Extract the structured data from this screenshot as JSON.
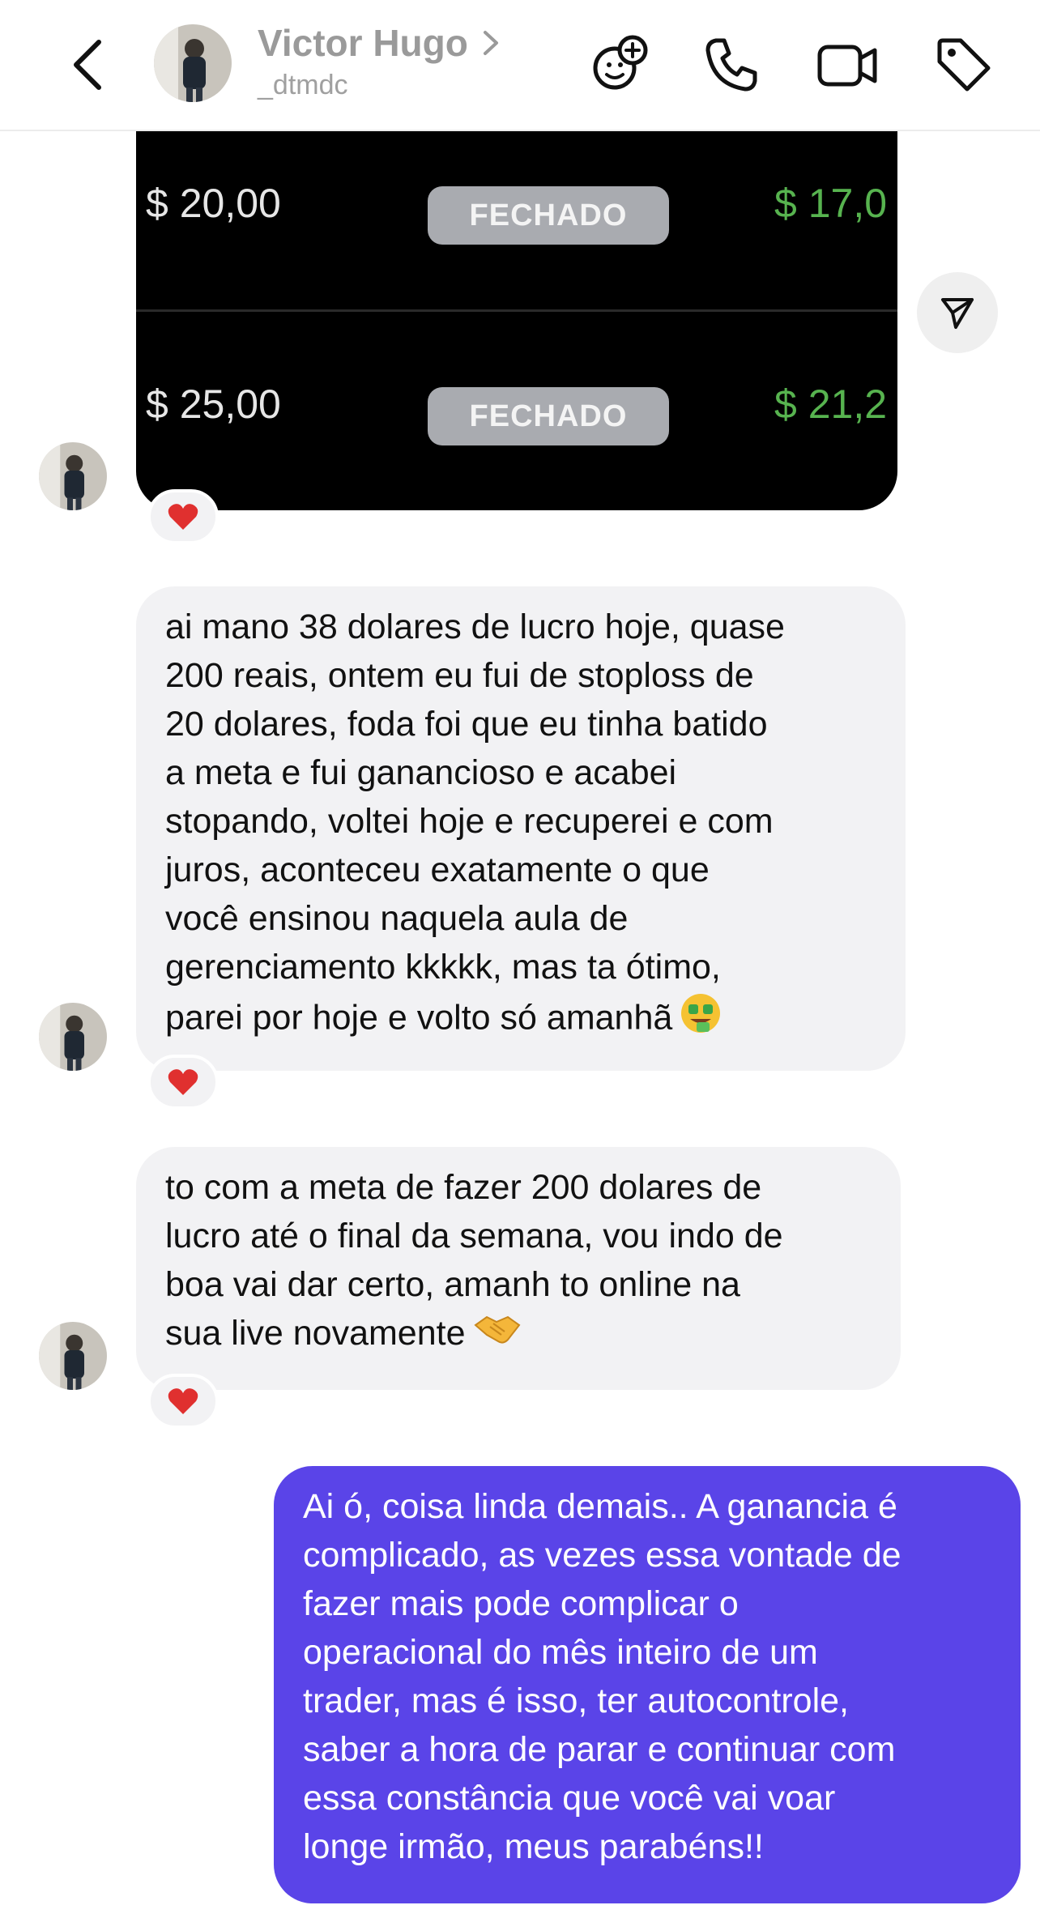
{
  "header": {
    "contact_name": "Victor Hugo",
    "handle": "_dtmdc",
    "icons": [
      "back-icon",
      "add-effect-icon",
      "phone-icon",
      "video-icon",
      "tag-icon"
    ]
  },
  "trade_image": {
    "rows": [
      {
        "price": "$ 20,00",
        "status": "FECHADO",
        "profit": "$ 17,0"
      },
      {
        "price": "$ 25,00",
        "status": "FECHADO",
        "profit": "$ 21,2"
      }
    ]
  },
  "messages": [
    {
      "direction": "incoming",
      "lines": [
        "ai mano 38 dolares de lucro hoje, quase",
        "200 reais, ontem eu fui de stoploss de",
        "20 dolares, foda foi que eu tinha batido",
        "a meta e fui ganancioso e acabei",
        "stopando, voltei hoje e recuperei e com",
        "juros, aconteceu exatamente o que",
        "você ensinou naquela aula de",
        "gerenciamento kkkkk, mas ta ótimo,",
        "parei por hoje e volto só amanhã"
      ],
      "reaction": "heart"
    },
    {
      "direction": "incoming",
      "lines": [
        "to com a meta de fazer 200 dolares de",
        "lucro até o final da semana, vou indo de",
        "boa vai dar certo, amanh to online na",
        "sua live novamente"
      ],
      "reaction": "heart"
    },
    {
      "direction": "outgoing",
      "lines": [
        "Ai ó, coisa linda demais.. A ganancia é",
        "complicado, as vezes essa vontade de",
        "fazer mais pode complicar o",
        "operacional do mês inteiro de um",
        "trader, mas é isso, ter autocontrole,",
        "saber a hora de parar e continuar com",
        "essa constância que você vai voar",
        "longe irmão, meus parabéns!!"
      ]
    }
  ],
  "colors": {
    "outgoing_bubble": "#5a44e8",
    "incoming_bubble": "#f2f2f4",
    "profit_green": "#57b34f",
    "heart": "#e0302f"
  }
}
